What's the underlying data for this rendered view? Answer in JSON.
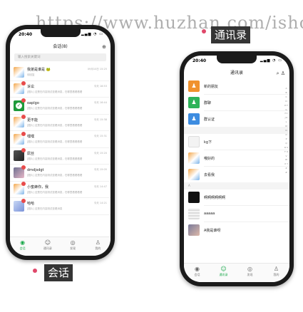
{
  "watermark": "https://www.huzhan.com/isho",
  "left_phone": {
    "time": "20:40",
    "status_icons": "▂▄▆ ◔ ▭",
    "title": "会话(8)",
    "add_icon": "plus-circle-icon",
    "search_placeholder": "输入搜索关键词",
    "conversations": [
      {
        "name": "我弟是谁是 🐸",
        "msg": "待回复",
        "time": "09月10日 15:25",
        "avatar": "cat",
        "badge": false
      },
      {
        "name": "诉讼",
        "msg": "[图片] 这是在内容测试查看消息，在哪里看看看看",
        "time": "今天 18:53",
        "avatar": "cat",
        "badge": true
      },
      {
        "name": "oaplgo",
        "msg": "[图片] 这是在内容测试查看消息，在哪里看看看看",
        "time": "今天 16:44",
        "avatar": "green",
        "badge": true
      },
      {
        "name": "更不能",
        "msg": "[图片] 这是在内容测试查看消息，在哪里看看看看",
        "time": "今天 15:38",
        "avatar": "cat",
        "badge": true
      },
      {
        "name": "嘿嘿",
        "msg": "[图片] 这是在内容测试查看消息，在哪里看看看看",
        "time": "今天 15:31",
        "avatar": "cat",
        "badge": true
      },
      {
        "name": "屌丝",
        "msg": "[图片] 这是在内容测试查看消息，在哪里看看看看",
        "time": "今天 15:20",
        "avatar": "dark",
        "badge": true
      },
      {
        "name": "dmdjsdgt",
        "msg": "[图片] 这是在内容测试查看消息，在哪里看看看看",
        "time": "今天 15:05",
        "avatar": "pink",
        "badge": true
      },
      {
        "name": "小蜜蜂你，我",
        "msg": "[图片] 这是在内容测试查看消息，在哪里看看看看",
        "time": "今天 14:47",
        "avatar": "cat",
        "badge": true
      },
      {
        "name": "哈哈",
        "msg": "[图片] 这是在内容测试查看消息",
        "time": "今天 14:21",
        "avatar": "blue",
        "badge": true
      }
    ],
    "tabs": [
      {
        "label": "会话",
        "icon": "chat-icon",
        "active": true
      },
      {
        "label": "通讯录",
        "icon": "contacts-icon",
        "active": false
      },
      {
        "label": "发现",
        "icon": "compass-icon",
        "active": false
      },
      {
        "label": "我的",
        "icon": "user-icon",
        "active": false
      }
    ]
  },
  "right_phone": {
    "time": "20:40",
    "status_icons": "▂▄▆ ◔ ▭",
    "title": "通讯录",
    "search_icon": "search-icon",
    "add_friend_icon": "add-user-icon",
    "fixed_items": [
      {
        "label": "新的朋友",
        "color": "orange",
        "icon": "person-add-icon"
      },
      {
        "label": "群聊",
        "color": "green",
        "icon": "group-icon"
      },
      {
        "label": "群认证",
        "color": "blue",
        "icon": "badge-icon"
      }
    ],
    "contacts": [
      {
        "section": "",
        "label": "kg下",
        "avatar": "white"
      },
      {
        "section": "",
        "label": "哦好的",
        "avatar": "cat"
      },
      {
        "section": "",
        "label": "去看我",
        "avatar": "cat"
      },
      {
        "section": "A",
        "label": "啊啊啊啊啊啊",
        "avatar": "black"
      },
      {
        "section": "",
        "label": "aaaaa",
        "avatar": "doc"
      },
      {
        "section": "",
        "label": "A我是谁呀",
        "avatar": "photo"
      }
    ],
    "index_letters": "A B C D E F G H I J K L M N O P Q R S T U V W X Y Z #",
    "tabs": [
      {
        "label": "会话",
        "icon": "chat-icon",
        "active": false
      },
      {
        "label": "通讯录",
        "icon": "contacts-icon",
        "active": true
      },
      {
        "label": "发现",
        "icon": "compass-icon",
        "active": false
      },
      {
        "label": "我的",
        "icon": "user-icon",
        "active": false
      }
    ]
  },
  "captions": {
    "contacts": "通讯录",
    "conversation": "会话"
  },
  "colors": {
    "accent_green": "#19a84a",
    "badge_red": "#e84b4b",
    "caption_bg": "#353535"
  }
}
